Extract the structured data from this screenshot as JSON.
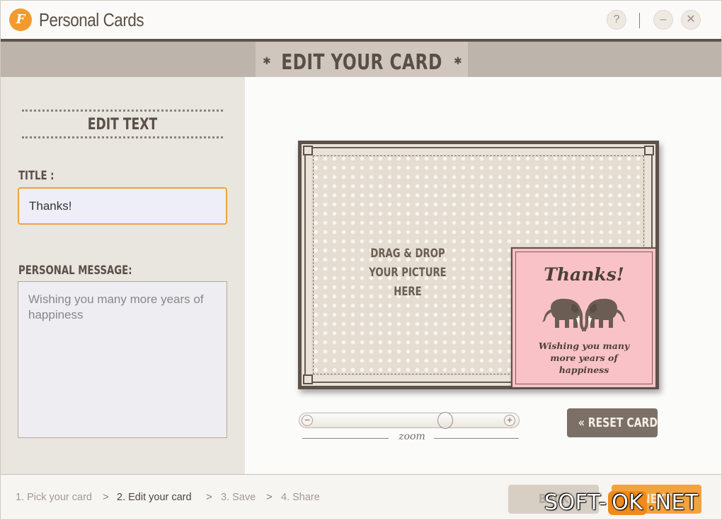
{
  "app": {
    "logo_letter": "F",
    "title": "Personal Cards"
  },
  "titlebar": {
    "help": "?",
    "minimize": "–",
    "close": "✕"
  },
  "header": {
    "title": "EDIT YOUR CARD",
    "star": "✱"
  },
  "editor": {
    "section_title": "EDIT TEXT",
    "title_label": "TITLE :",
    "title_value": "Thanks!",
    "message_label": "PERSONAL MESSAGE:",
    "message_value": "Wishing you many more years of happiness"
  },
  "card": {
    "drop_line1": "DRAG & DROP",
    "drop_line2": "YOUR PICTURE HERE",
    "note_title": "Thanks!",
    "note_message_lines": [
      "Wishing you many",
      "more years of",
      "happiness"
    ]
  },
  "zoom": {
    "label": "zoom",
    "minus": "−",
    "plus": "+",
    "level": 0.66
  },
  "reset_label": "« RESET CARD",
  "steps": [
    {
      "label": "1. Pick your card",
      "active": false
    },
    {
      "label": "2. Edit your card",
      "active": true
    },
    {
      "label": "3. Save",
      "active": false
    },
    {
      "label": "4. Share",
      "active": false
    }
  ],
  "step_separator": ">",
  "nav": {
    "back_label": "BACK",
    "next_label": "NEXT"
  },
  "watermark": {
    "pre": "SOFT-",
    "ok": "OK",
    "post": ".NET"
  },
  "colors": {
    "accent": "#f39a2e",
    "brown": "#5e5249",
    "note_pink": "#f9c2c6"
  }
}
